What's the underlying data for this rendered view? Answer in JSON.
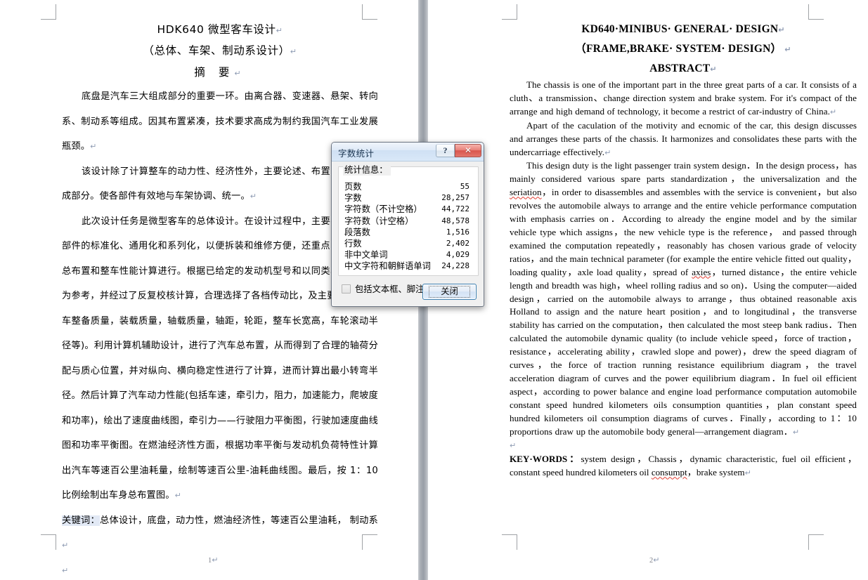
{
  "document": {
    "left_page": {
      "title_line1": "HDK640 微型客车设计",
      "title_line2": "（总体、车架、制动系设计）",
      "title_line3": "摘 要",
      "para1": "底盘是汽车三大组成部分的重要一环。由离合器、变速器、悬架、转向系、制动系等组成。因其布置紧凑，技术要求高成为制约我国汽车工业发展瓶颈。",
      "para2": "该设计除了计算整车的动力性、经济性外，主要论述、布置了底盘各组成部分。使各部件有效地与车架协调、统一。",
      "para3": "此次设计任务是微型客车的总体设计。在设计过程中，主要考虑了各零部件的标准化、通用化和系列化，以便拆装和维修方便，还重点围绕整车的总布置和整车性能计算进行。根据已给定的发动机型号和以同类车型的整车为参考，并经过了反复校核计算，合理选择了各档传动比，及主要参数(如整车整备质量，装载质量，轴载质量，轴距，轮距，整车长宽高，车轮滚动半径等)。利用计算机辅助设计，进行了汽车总布置，从而得到了合理的轴荷分配与质心位置，并对纵向、横向稳定性进行了计算，进而计算出最小转弯半径。然后计算了汽车动力性能(包括车速，牵引力，阻力，加速能力，爬坡度和功率)，绘出了速度曲线图，牵引力——行驶阻力平衡图，行驶加速度曲线图和功率平衡图。在燃油经济性方面，根据功率平衡与发动机负荷特性计算出汽车等速百公里油耗量，绘制等速百公里-油耗曲线图。最后，按 1：10 比例绘制出车身总布置图。",
      "keywords_label": "关键词：",
      "keywords_value": "总体设计，底盘，动力性，燃油经济性，等速百公里油耗， 制动系",
      "page_number": "1"
    },
    "right_page": {
      "title_line1": "KD640·MINIBUS· GENERAL· DESIGN",
      "title_line2": "（FRAME,BRAKE· SYSTEM· DESIGN）",
      "title_line3": "ABSTRACT",
      "para1": "The chassis is one of the important part in the three great parts of a car. It consists of a cluth、a transmission、change direction system and brake system. For it's compact of the arrange and high demand of technology, it become a restrict of car-industry of China.",
      "para2": "Apart of the caculation of the motivity and ecnomic of the car, this design discusses and arranges these parts of the chassis. It harmonizes and consolidates these parts with the undercarriage effectively.",
      "para3_a": "This design duty is the light passenger train system design．In the design process，has mainly considered various spare parts standardization，the universalization and the ",
      "para3_misspell1": "seriation",
      "para3_b": "，in order to disassembles and assembles with the service is convenient，but also revolves the automobile always to arrange and the entire vehicle performance computation with emphasis carries on．According to already the engine model and by the similar vehicle type which assigns，the new vehicle type is the reference， and passed through examined the computation repeatedly，reasonably has chosen various grade of velocity ratios，and the main technical parameter (for example the entire vehicle fitted out quality，loading quality，axle load quality，spread of ",
      "para3_misspell2": "axies",
      "para3_c": "，turned distance，the entire vehicle length and breadth was high，wheel rolling radius and so on)．Using the computer—aided design，carried on the automobile always to arrange，thus obtained reasonable axis Holland to assign and the nature heart position，and to longitudinal，the transverse stability has carried on the computation，then calculated the most steep bank radius．Then calculated the automobile dynamic quality (to include vehicle speed，force of traction，resistance，accelerating ability，crawled slope and power)，drew the speed diagram of curves，the force of traction running resistance equilibrium diagram，the travel acceleration diagram of curves and the power equilibrium diagram．In fuel oil efficient aspect，according to power balance and engine load performance computation automobile constant speed hundred kilometers oils consumption quantities，plan constant speed hundred kilometers oil consumption diagrams of curves．Finally，according to 1：10 proportions draw up the automobile body general—arrangement diagram．",
      "keywords_label": "KEY·WORDS：",
      "keywords_a": "system design，Chassis，dynamic characteristic, fuel oil efficient， constant speed hundred kilometers oil ",
      "keywords_misspell": "consumpt",
      "keywords_b": "，brake system",
      "page_number": "2"
    }
  },
  "dialog": {
    "title": "字数统计",
    "help_button": "?",
    "close_button": "✕",
    "group_label": "统计信息：",
    "stats": [
      {
        "label": "页数",
        "value": "55"
      },
      {
        "label": "字数",
        "value": "28,257"
      },
      {
        "label": "字符数（不计空格）",
        "value": "44,722"
      },
      {
        "label": "字符数（计空格）",
        "value": "48,578"
      },
      {
        "label": "段落数",
        "value": "1,516"
      },
      {
        "label": "行数",
        "value": "2,402"
      },
      {
        "label": "非中文单词",
        "value": "4,029"
      },
      {
        "label": "中文字符和朝鲜语单词",
        "value": "24,228"
      }
    ],
    "checkbox_label": "包括文本框、脚注和尾注 (F)",
    "checkbox_checked": false,
    "close_label": "关闭"
  },
  "colors": {
    "accent": "#3c7fb1",
    "close_red": "#d9554d",
    "misspell_red": "#e03a30",
    "pilcrow": "#8e9bb3",
    "gutter": "#989ea6"
  }
}
